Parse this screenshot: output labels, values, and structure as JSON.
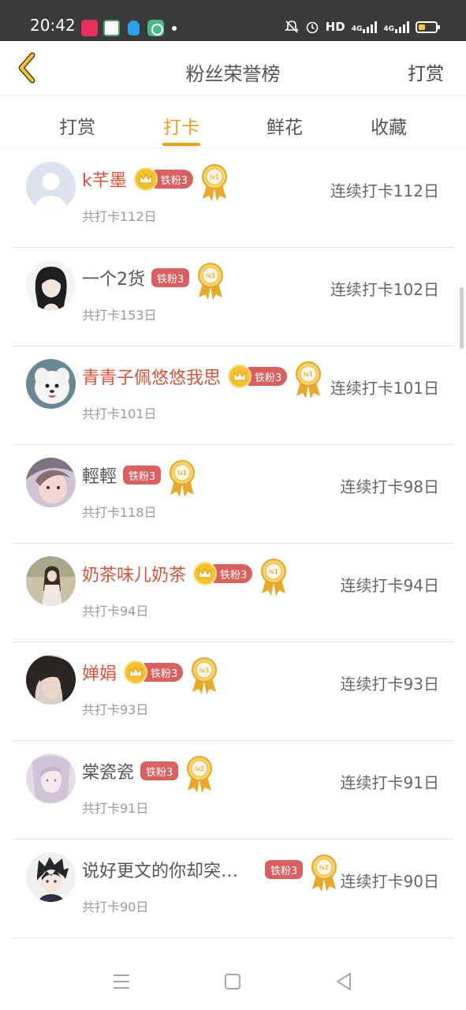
{
  "status_bar": {
    "time": "20:42",
    "network": "HD",
    "signal_1": "4G",
    "signal_2": "4G",
    "app_icons": [
      "news-app-icon",
      "heart-app-icon",
      "qq-icon",
      "camera-app-icon"
    ]
  },
  "header": {
    "title": "粉丝荣誉榜",
    "right_action": "打赏",
    "back_icon": "chevron-left-icon"
  },
  "tabs": [
    {
      "label": "打赏",
      "active": false
    },
    {
      "label": "打卡",
      "active": true
    },
    {
      "label": "鲜花",
      "active": false
    },
    {
      "label": "收藏",
      "active": false
    }
  ],
  "colors": {
    "accent": "#f0a020",
    "vip_name": "#d9533a",
    "badge_bg": "#d96060",
    "status_bar": "#3a3a3a"
  },
  "fans": [
    {
      "name": "k芊墨",
      "vip": true,
      "badge": "铁粉3",
      "level": "lv1",
      "total": "共打卡112日",
      "streak": "连续打卡112日",
      "avatar": "default-avatar"
    },
    {
      "name": "一个2货",
      "vip": false,
      "badge": "铁粉3",
      "level": "lv3",
      "total": "共打卡153日",
      "streak": "连续打卡102日",
      "avatar": "girl-portrait"
    },
    {
      "name": "青青子佩悠悠我思",
      "vip": true,
      "badge": "铁粉3",
      "level": "lv1",
      "total": "共打卡101日",
      "streak": "连续打卡101日",
      "avatar": "white-dog"
    },
    {
      "name": "輕輕",
      "vip": false,
      "badge": "铁粉3",
      "level": "lv1",
      "total": "共打卡118日",
      "streak": "连续打卡98日",
      "avatar": "girl-photo"
    },
    {
      "name": "奶茶味儿奶茶",
      "vip": true,
      "badge": "铁粉3",
      "level": "lv1",
      "total": "共打卡94日",
      "streak": "连续打卡94日",
      "avatar": "girl-standing"
    },
    {
      "name": "婵娟",
      "vip": true,
      "badge": "铁粉3",
      "level": "lv3",
      "total": "共打卡93日",
      "streak": "连续打卡93日",
      "avatar": "dark-hair-portrait"
    },
    {
      "name": "棠瓷瓷",
      "vip": false,
      "badge": "铁粉3",
      "level": "lv2",
      "total": "共打卡91日",
      "streak": "连续打卡91日",
      "avatar": "pale-illustration"
    },
    {
      "name": "说好更文的你却突…",
      "vip": false,
      "badge": "铁粉3",
      "level": "lv2",
      "total": "共打卡90日",
      "streak": "连续打卡90日",
      "avatar": "anime-boy"
    }
  ]
}
